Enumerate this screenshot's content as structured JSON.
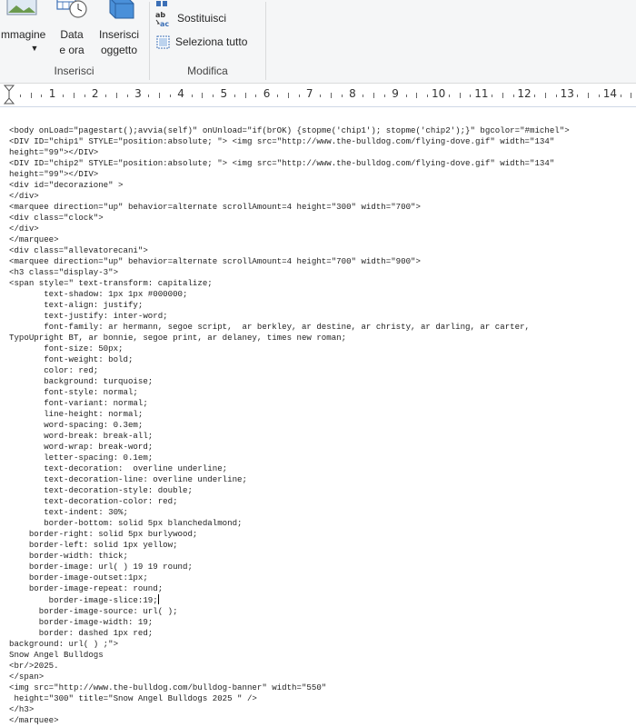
{
  "ribbon": {
    "buttons": {
      "image": "Immagine",
      "datetime_line1": "Data",
      "datetime_line2": "e ora",
      "object_line1": "Inserisci",
      "object_line2": "oggetto",
      "replace": "Sostituisci",
      "select_all": "Seleziona tutto"
    },
    "groups": {
      "insert": "Inserisci",
      "edit": "Modifica"
    }
  },
  "ruler": {
    "numbers": [
      "1",
      "2",
      "3",
      "4",
      "5",
      "6",
      "7",
      "8",
      "9",
      "10",
      "11",
      "12",
      "13",
      "14"
    ]
  },
  "document": {
    "lines": [
      "<body onLoad=\"pagestart();avvia(self)\" onUnload=\"if(brOK) {stopme('chip1'); stopme('chip2');}\" bgcolor=\"#michel\">",
      "<DIV ID=\"chip1\" STYLE=\"position:absolute; \"> <img src=\"http://www.the-bulldog.com/flying-dove.gif\" width=\"134\"",
      "height=\"99\"></DIV>",
      "<DIV ID=\"chip2\" STYLE=\"position:absolute; \"> <img src=\"http://www.the-bulldog.com/flying-dove.gif\" width=\"134\"",
      "height=\"99\"></DIV>",
      "<div id=\"decorazione\" >",
      "</div>",
      "<marquee direction=\"up\" behavior=alternate scrollAmount=4 height=\"300\" width=\"700\">",
      "<div class=\"clock\">",
      "</div>",
      "</marquee>",
      "<div class=\"allevatorecani\">",
      "<marquee direction=\"up\" behavior=alternate scrollAmount=4 height=\"700\" width=\"900\">",
      "<h3 class=\"display-3\">",
      "<span style=\" text-transform: capitalize;",
      "       text-shadow: 1px 1px #000000;",
      "       text-align: justify;",
      "       text-justify: inter-word;",
      "       font-family: ar hermann, segoe script,  ar berkley, ar destine, ar christy, ar darling, ar carter,",
      "TypoUpright BT, ar bonnie, segoe print, ar delaney, times new roman;",
      "       font-size: 50px;",
      "       font-weight: bold;",
      "       color: red;",
      "       background: turquoise;",
      "       font-style: normal;",
      "       font-variant: normal;",
      "       line-height: normal;",
      "       word-spacing: 0.3em;",
      "       word-break: break-all;",
      "       word-wrap: break-word;",
      "       letter-spacing: 0.1em;",
      "       text-decoration:  overline underline;",
      "       text-decoration-line: overline underline;",
      "       text-decoration-style: double;",
      "       text-decoration-color: red;",
      "       text-indent: 30%;",
      "       border-bottom: solid 5px blanchedalmond;",
      "    border-right: solid 5px burlywood;",
      "    border-left: solid 1px yellow;",
      "    border-width: thick;",
      "    border-image: url( ) 19 19 round;",
      "    border-image-outset:1px;",
      "    border-image-repeat: round;",
      "        border-image-slice:19;",
      "      border-image-source: url( );",
      "      border-image-width: 19;",
      "      border: dashed 1px red;",
      "background: url( ) ;\">",
      "Snow Angel Bulldogs",
      "<br/>2025.",
      "</span>",
      "<img src=\"http://www.the-bulldog.com/bulldog-banner\" width=\"550\"",
      " height=\"300\" title=\"Snow Angel Bulldogs 2025 \" />",
      "</h3>",
      "</marquee>"
    ]
  }
}
